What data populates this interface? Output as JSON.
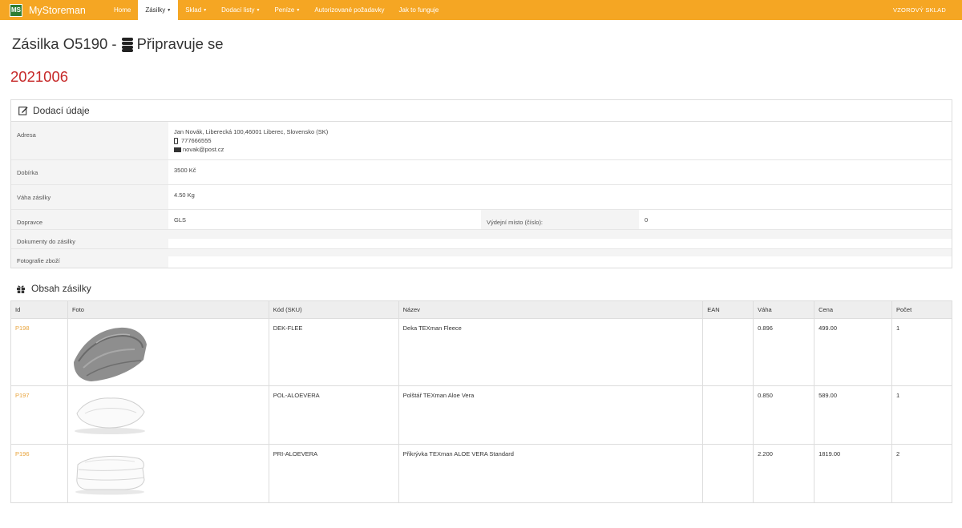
{
  "navbar": {
    "logo_text": "MS",
    "brand": "MyStoreman",
    "items": [
      {
        "label": "Home",
        "dropdown": false,
        "active": false
      },
      {
        "label": "Zásilky",
        "dropdown": true,
        "active": true
      },
      {
        "label": "Sklad",
        "dropdown": true,
        "active": false
      },
      {
        "label": "Dodací listy",
        "dropdown": true,
        "active": false
      },
      {
        "label": "Peníze",
        "dropdown": true,
        "active": false
      },
      {
        "label": "Autorizované požadavky",
        "dropdown": false,
        "active": false
      },
      {
        "label": "Jak to funguje",
        "dropdown": false,
        "active": false
      }
    ],
    "right_label": "VZOROVÝ SKLAD",
    "accent_color": "#f5a623"
  },
  "page": {
    "title_prefix": "Zásilka O5190 -",
    "title_icon": "database-stack-icon",
    "title_status": "Připravuje se",
    "order_number": "2021006"
  },
  "delivery": {
    "heading": "Dodací údaje",
    "heading_icon": "edit-icon",
    "address_label": "Adresa",
    "address": "Jan Novák, Liberecká 100,46001 Liberec, Slovensko (SK)",
    "phone": "777666555",
    "email": "novak@post.cz",
    "cod_label": "Dobírka",
    "cod_value": "3500 Kč",
    "weight_label": "Váha zásilky",
    "weight_value": "4.50 Kg",
    "carrier_label": "Dopravce",
    "carrier_value": "GLS",
    "pickup_label": "Výdejní místo (číslo):",
    "pickup_value": "0",
    "documents_label": "Dokumenty do zásilky",
    "photos_label": "Fotografie zboží"
  },
  "contents": {
    "heading": "Obsah zásilky",
    "heading_icon": "gift-icon",
    "columns": [
      "Id",
      "Foto",
      "Kód (SKU)",
      "Název",
      "EAN",
      "Váha",
      "Cena",
      "Počet"
    ],
    "rows": [
      {
        "id": "P198",
        "photo": "gray-blanket",
        "sku": "DEK-FLEE",
        "name": "Deka TEXman Fleece",
        "ean": "",
        "weight": "0.896",
        "price": "499.00",
        "qty": "1"
      },
      {
        "id": "P197",
        "photo": "white-pillow",
        "sku": "POL-ALOEVERA",
        "name": "Polštář TEXman Aloe Vera",
        "ean": "",
        "weight": "0.850",
        "price": "589.00",
        "qty": "1"
      },
      {
        "id": "P196",
        "photo": "white-duvet",
        "sku": "PRI-ALOEVERA",
        "name": "Přikrývka TEXman ALOE VERA Standard",
        "ean": "",
        "weight": "2.200",
        "price": "1819.00",
        "qty": "2"
      }
    ]
  }
}
